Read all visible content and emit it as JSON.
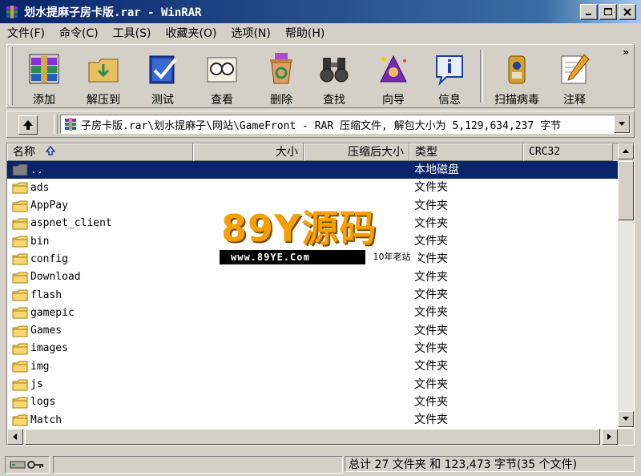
{
  "window": {
    "title": "划水提麻子房卡版.rar - WinRAR"
  },
  "menu": [
    "文件(F)",
    "命令(C)",
    "工具(S)",
    "收藏夹(O)",
    "选项(N)",
    "帮助(H)"
  ],
  "toolbar": [
    "添加",
    "解压到",
    "测试",
    "查看",
    "删除",
    "查找",
    "向导",
    "信息",
    "扫描病毒",
    "注释"
  ],
  "address": {
    "path": "子房卡版.rar\\划水提麻子\\网站\\GameFront - RAR 压缩文件, 解包大小为 5,129,634,237 字节"
  },
  "columns": {
    "name": "名称",
    "size": "大小",
    "packed": "压缩后大小",
    "type": "类型",
    "crc": "CRC32"
  },
  "rows": [
    {
      "name": "..",
      "type": "本地磁盘"
    },
    {
      "name": "ads",
      "type": "文件夹"
    },
    {
      "name": "AppPay",
      "type": "文件夹"
    },
    {
      "name": "aspnet_client",
      "type": "文件夹"
    },
    {
      "name": "bin",
      "type": "文件夹"
    },
    {
      "name": "config",
      "type": "文件夹"
    },
    {
      "name": "Download",
      "type": "文件夹"
    },
    {
      "name": "flash",
      "type": "文件夹"
    },
    {
      "name": "gamepic",
      "type": "文件夹"
    },
    {
      "name": "Games",
      "type": "文件夹"
    },
    {
      "name": "images",
      "type": "文件夹"
    },
    {
      "name": "img",
      "type": "文件夹"
    },
    {
      "name": "js",
      "type": "文件夹"
    },
    {
      "name": "logs",
      "type": "文件夹"
    },
    {
      "name": "Match",
      "type": "文件夹"
    }
  ],
  "watermark": {
    "logo": "89Y源码",
    "url": "www.89YE.Com",
    "tagline": "10年老站"
  },
  "status": {
    "summary": "总计 27 文件夹 和 123,473 字节(35 个文件)"
  }
}
